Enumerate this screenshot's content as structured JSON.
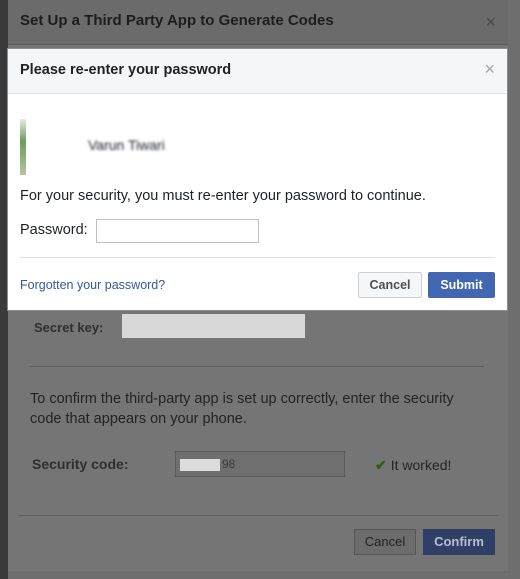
{
  "background_dialog": {
    "title": "Set Up a Third Party App to Generate Codes",
    "close_glyph": "×",
    "secret_key_label": "Secret key:",
    "confirm_text": "To confirm the third-party app is set up correctly, enter the security code that appears on your phone.",
    "security_code_label": "Security code:",
    "security_code_value": "98",
    "worked_text": "It worked!",
    "check_icon": "✔",
    "cancel_label": "Cancel",
    "confirm_label": "Confirm"
  },
  "modal": {
    "title": "Please re-enter your password",
    "close_glyph": "×",
    "username": "Varun Tiwari",
    "security_message": "For your security, you must re-enter your password to continue.",
    "password_label": "Password:",
    "password_value": "",
    "forgot_link": "Forgotten your password?",
    "cancel_label": "Cancel",
    "submit_label": "Submit"
  },
  "colors": {
    "overlay": "#6e6e6e",
    "primary": "#4267b2",
    "link": "#365899"
  }
}
